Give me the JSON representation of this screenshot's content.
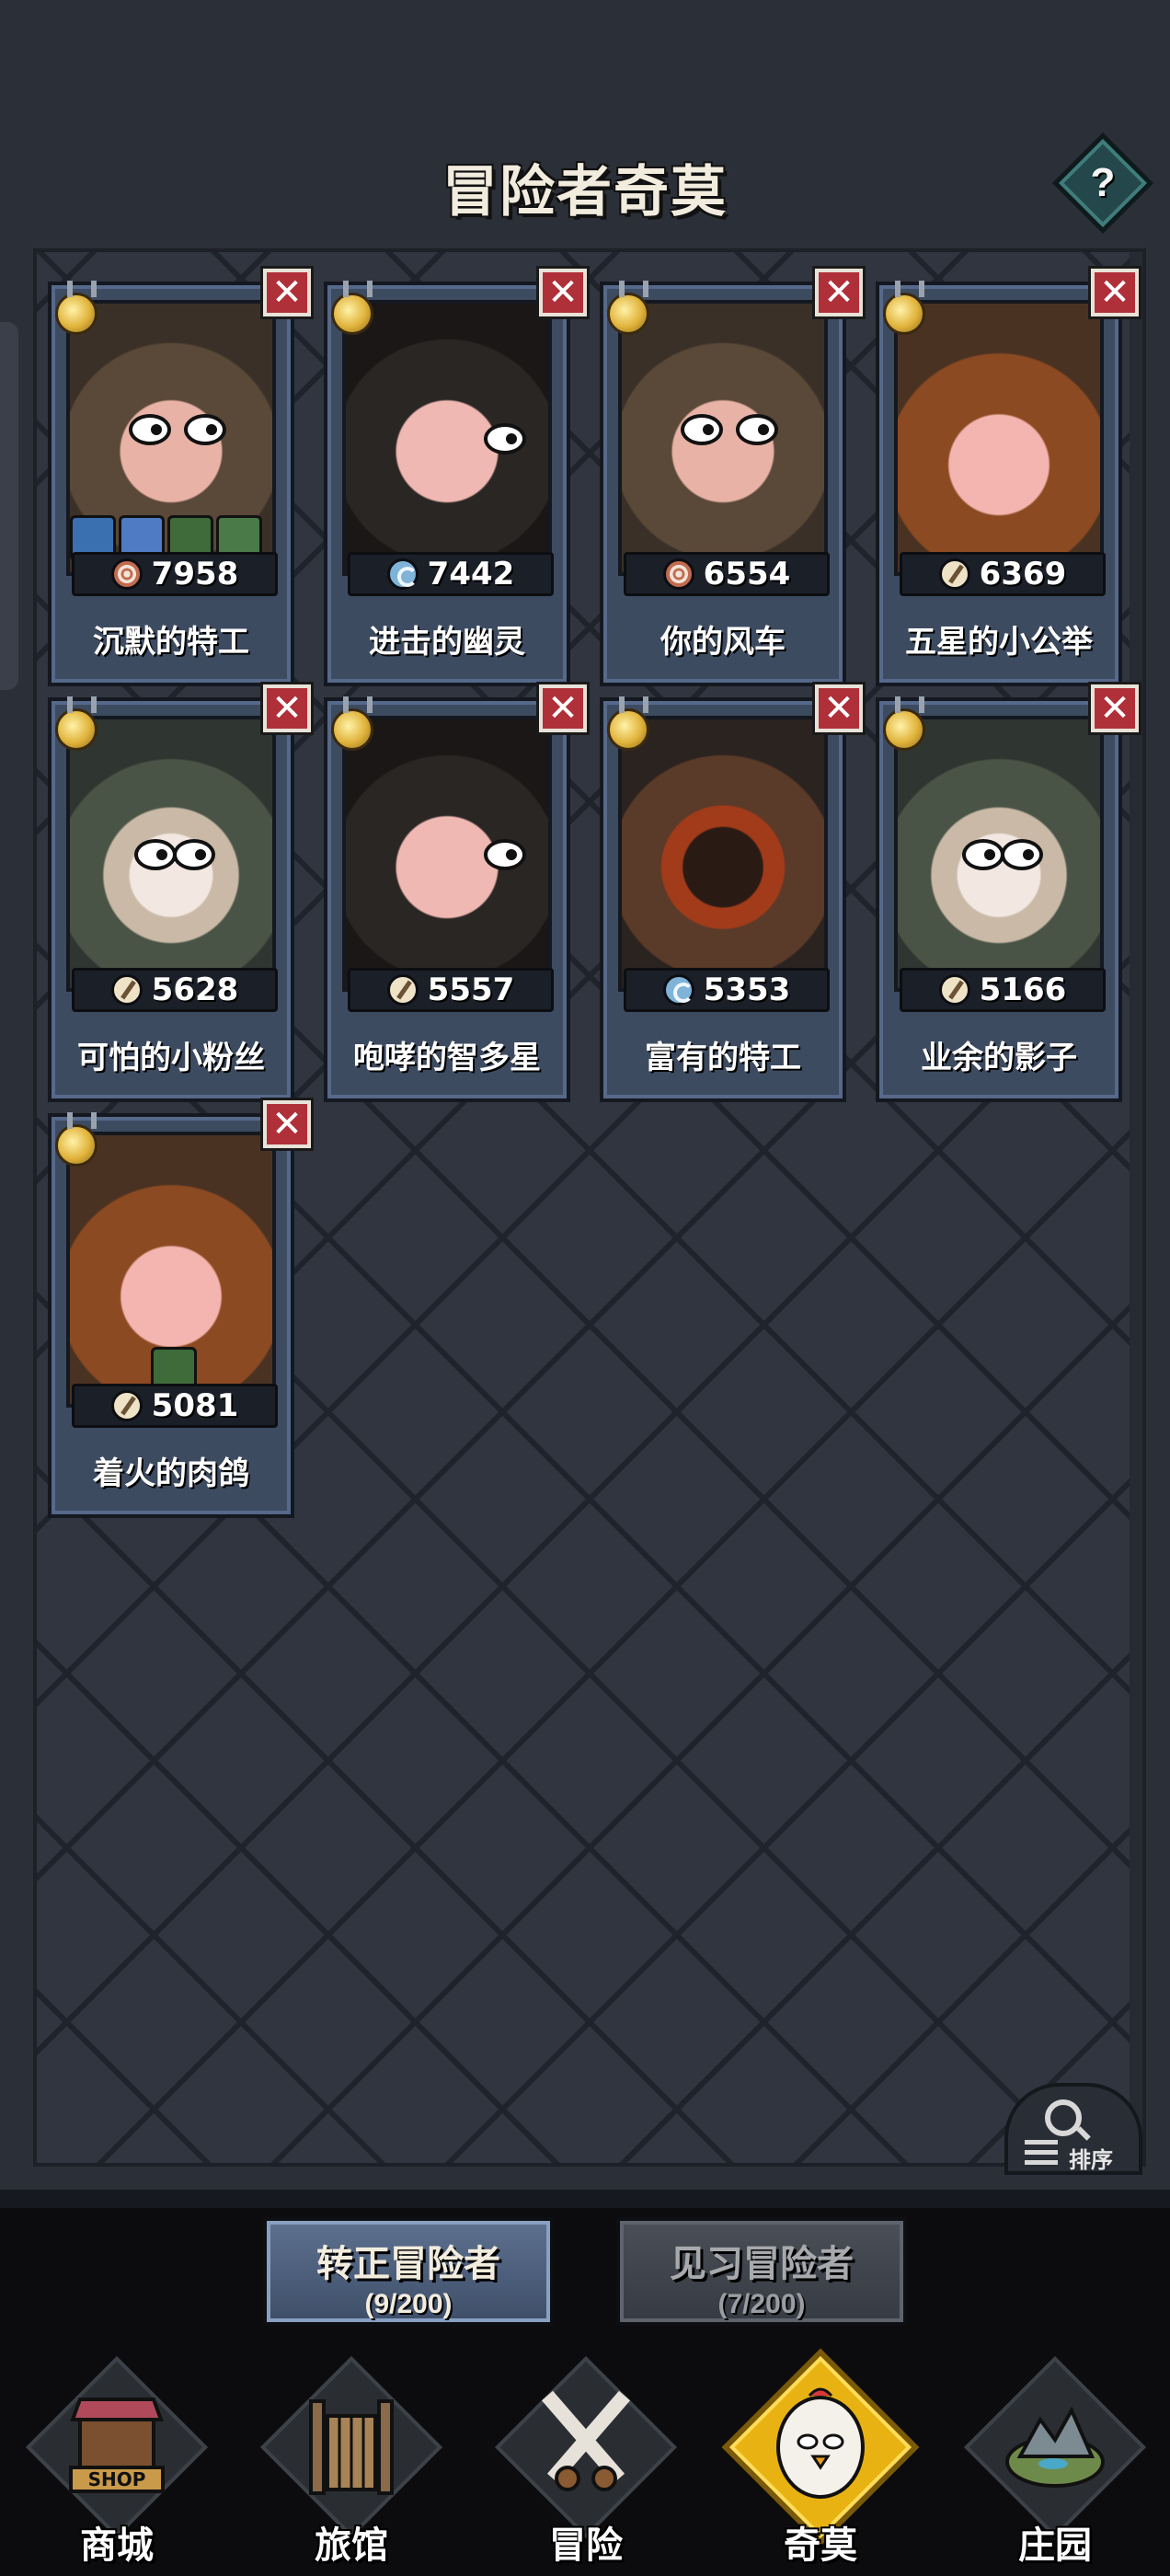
{
  "header": {
    "title": "冒险者奇莫",
    "help_symbol": "?"
  },
  "close_symbol": "✕",
  "cards": [
    {
      "name": "沉默的特工",
      "power": "7958",
      "class_icon": "target-icon",
      "portrait": "hair-brown",
      "has_skills": true
    },
    {
      "name": "进击的幽灵",
      "power": "7442",
      "class_icon": "magic-icon",
      "portrait": "hair-dark",
      "has_skills": false
    },
    {
      "name": "你的风车",
      "power": "6554",
      "class_icon": "target-icon",
      "portrait": "hair-brown",
      "has_skills": false
    },
    {
      "name": "五星的小公举",
      "power": "6369",
      "class_icon": "sword-icon",
      "portrait": "pumpkin",
      "has_skills": false
    },
    {
      "name": "可怕的小粉丝",
      "power": "5628",
      "class_icon": "sword-icon",
      "portrait": "hood-green",
      "has_skills": false
    },
    {
      "name": "咆哮的智多星",
      "power": "5557",
      "class_icon": "sword-icon",
      "portrait": "hair-dark",
      "has_skills": false
    },
    {
      "name": "富有的特工",
      "power": "5353",
      "class_icon": "magic-icon",
      "portrait": "cowboy",
      "has_skills": false
    },
    {
      "name": "业余的影子",
      "power": "5166",
      "class_icon": "sword-icon",
      "portrait": "hood-green",
      "has_skills": false
    },
    {
      "name": "着火的肉鸽",
      "power": "5081",
      "class_icon": "sword-icon",
      "portrait": "pumpkin",
      "has_skills": false
    }
  ],
  "sort_button": {
    "label": "排序"
  },
  "tabs": [
    {
      "label": "转正冒险者",
      "count": "(9/200)",
      "active": true
    },
    {
      "label": "见习冒险者",
      "count": "(7/200)",
      "active": false
    }
  ],
  "nav": [
    {
      "label": "商城",
      "icon": "shop-icon",
      "badge": "SHOP"
    },
    {
      "label": "旅馆",
      "icon": "gate-icon"
    },
    {
      "label": "冒险",
      "icon": "crossed-swords-icon"
    },
    {
      "label": "奇莫",
      "icon": "chicken-mascot-icon",
      "active": true
    },
    {
      "label": "庄园",
      "icon": "island-icon"
    }
  ],
  "colors": {
    "accent_gold": "#e8b312",
    "close_red": "#b0303a",
    "card_blue": "#3d4b61"
  }
}
